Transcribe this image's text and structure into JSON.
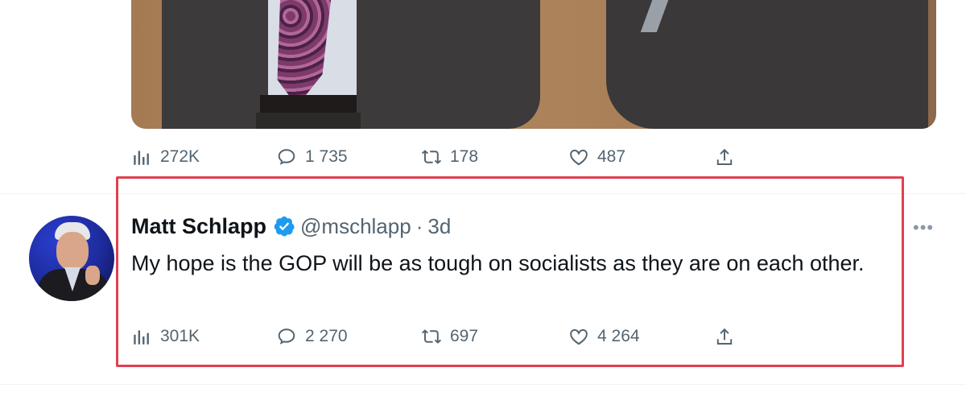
{
  "previous_tweet": {
    "actions": {
      "views": "272K",
      "replies": "1 735",
      "retweets": "178",
      "likes": "487"
    }
  },
  "tweet": {
    "author_name": "Matt Schlapp",
    "handle": "@mschlapp",
    "separator": "·",
    "time": "3d",
    "text": "My hope is the GOP will be as tough on socialists as they are on each other.",
    "more_label": "•••",
    "actions": {
      "views": "301K",
      "replies": "2 270",
      "retweets": "697",
      "likes": "4 264"
    }
  },
  "colors": {
    "highlight_border": "#e0404f",
    "verified_badge": "#1d9bf0",
    "secondary_text": "#536471"
  },
  "icons": [
    "views-icon",
    "reply-icon",
    "retweet-icon",
    "like-icon",
    "share-icon",
    "verified-badge-icon",
    "more-options-icon"
  ]
}
